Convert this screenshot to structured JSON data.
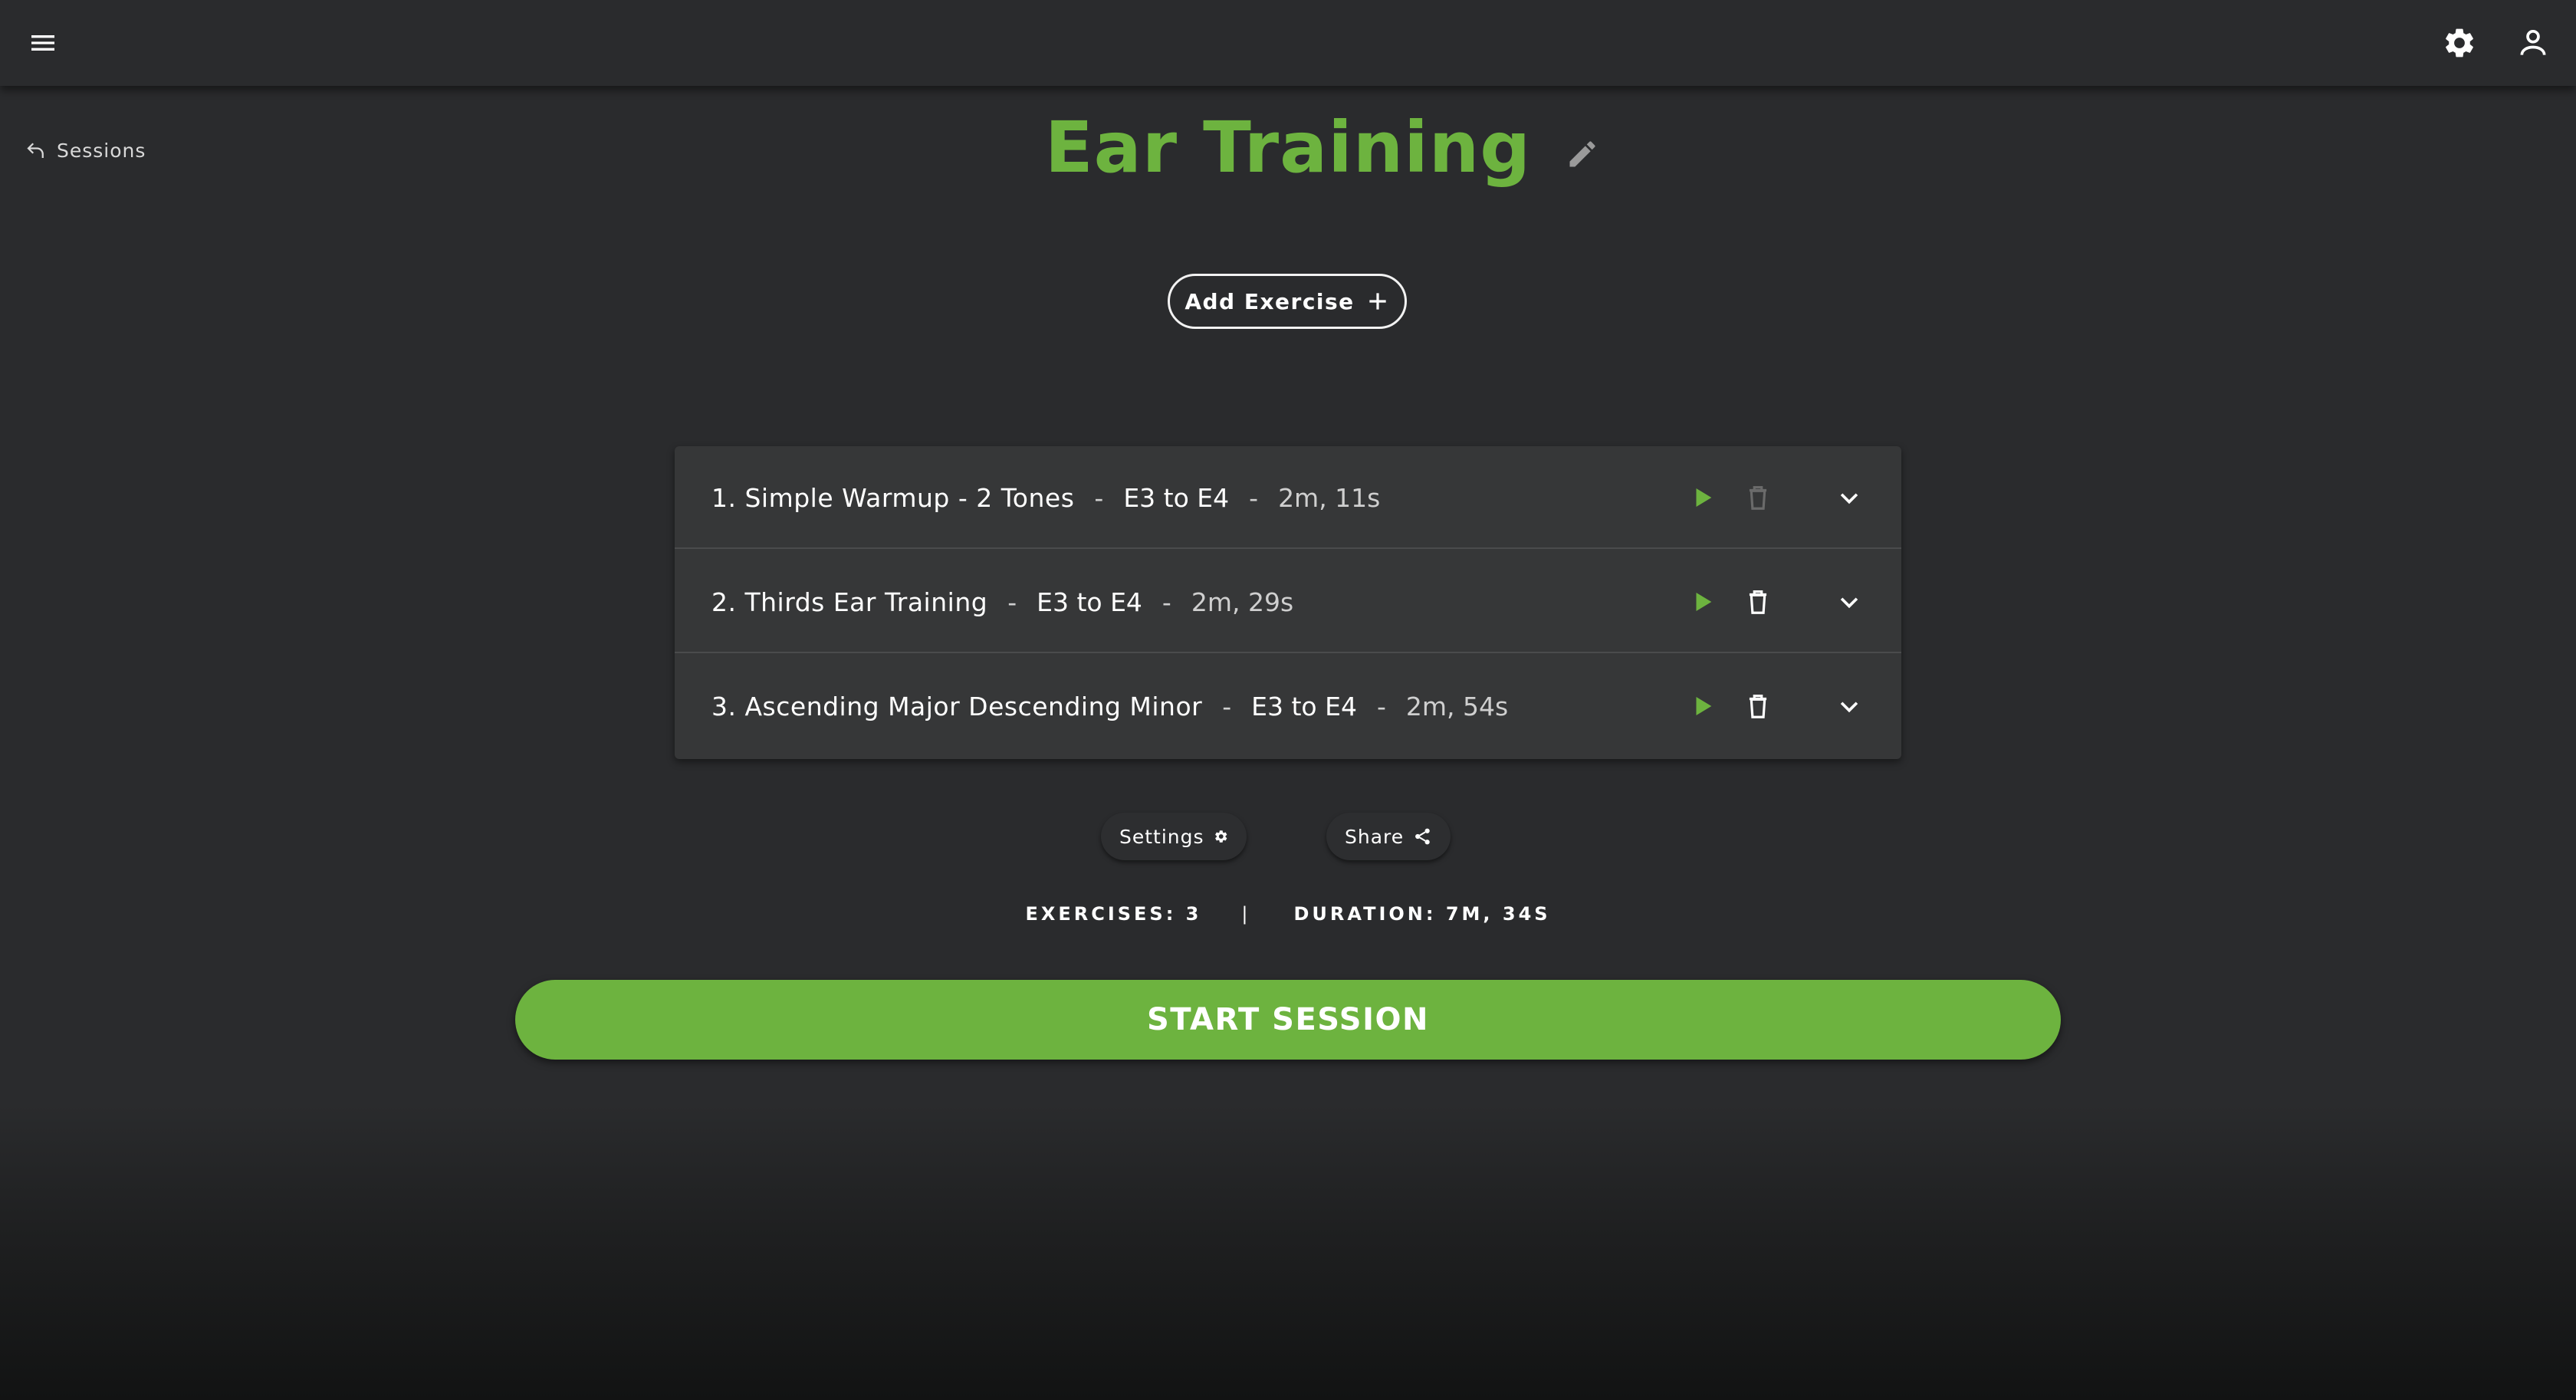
{
  "header": {
    "menu_icon": "hamburger-menu-icon",
    "settings_icon": "gear-icon",
    "account_icon": "person-icon"
  },
  "back_link": {
    "label": "Sessions",
    "icon": "undo-arrow-icon"
  },
  "session": {
    "title": "Ear Training",
    "edit_icon": "pencil-icon"
  },
  "add_exercise": {
    "label": "Add Exercise",
    "icon": "plus-icon"
  },
  "separator": "-",
  "exercises": [
    {
      "name": "1. Simple Warmup - 2 Tones",
      "range": "E3 to E4",
      "duration": "2m, 11s",
      "delete_enabled": false
    },
    {
      "name": "2. Thirds Ear Training",
      "range": "E3 to E4",
      "duration": "2m, 29s",
      "delete_enabled": true
    },
    {
      "name": "3. Ascending Major Descending Minor",
      "range": "E3 to E4",
      "duration": "2m, 54s",
      "delete_enabled": true
    }
  ],
  "actions": {
    "settings_label": "Settings",
    "share_label": "Share",
    "settings_icon": "gear-icon",
    "share_icon": "share-icon"
  },
  "stats": {
    "exercises": "EXERCISES: 3",
    "divider": "|",
    "duration": "DURATION: 7M, 34S"
  },
  "start_button": {
    "label": "START SESSION"
  },
  "colors": {
    "accent": "#6db33f",
    "background": "#2a2b2d",
    "card": "#363738",
    "disabled_icon": "#6a6a6a"
  }
}
